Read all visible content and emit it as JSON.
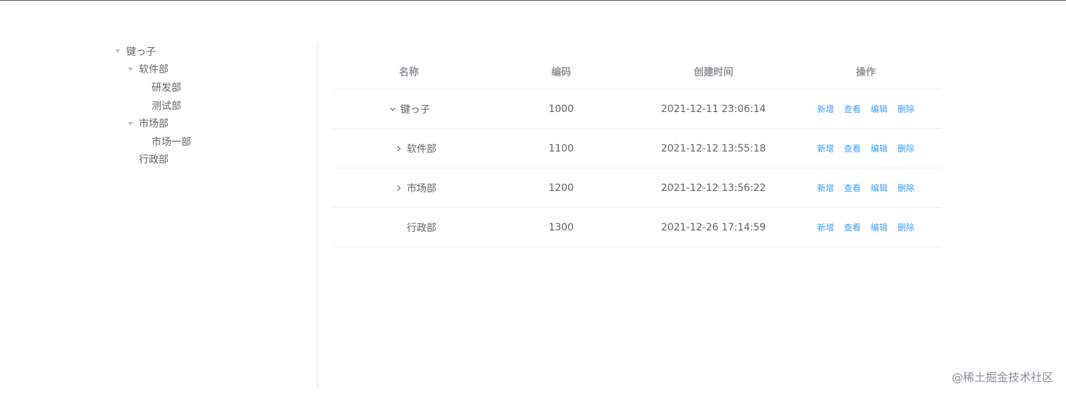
{
  "tree": {
    "nodes": [
      {
        "label": "键っ子",
        "level": 0,
        "expanded": true
      },
      {
        "label": "软件部",
        "level": 1,
        "expanded": true
      },
      {
        "label": "研发部",
        "level": 2,
        "expanded": false
      },
      {
        "label": "测试部",
        "level": 2,
        "expanded": false
      },
      {
        "label": "市场部",
        "level": 1,
        "expanded": true
      },
      {
        "label": "市场一部",
        "level": 2,
        "expanded": false
      },
      {
        "label": "行政部",
        "level": 1,
        "expanded": false
      }
    ]
  },
  "table": {
    "headers": {
      "name": "名称",
      "code": "编码",
      "created": "创建时间",
      "actions": "操作"
    },
    "rows": [
      {
        "name": "键っ子",
        "code": "1000",
        "created": "2021-12-11 23:06:14",
        "expand": "expanded"
      },
      {
        "name": "软件部",
        "code": "1100",
        "created": "2021-12-12 13:55:18",
        "expand": "collapsed"
      },
      {
        "name": "市场部",
        "code": "1200",
        "created": "2021-12-12 13:56:22",
        "expand": "collapsed"
      },
      {
        "name": "行政部",
        "code": "1300",
        "created": "2021-12-26 17:14:59",
        "expand": "none"
      }
    ],
    "actions": {
      "add": "新增",
      "view": "查看",
      "edit": "编辑",
      "delete": "删除"
    }
  },
  "watermark": "@稀土掘金技术社区",
  "colors": {
    "link": "#409eff",
    "text": "#606266",
    "header": "#909399",
    "border": "#ebeef5"
  }
}
